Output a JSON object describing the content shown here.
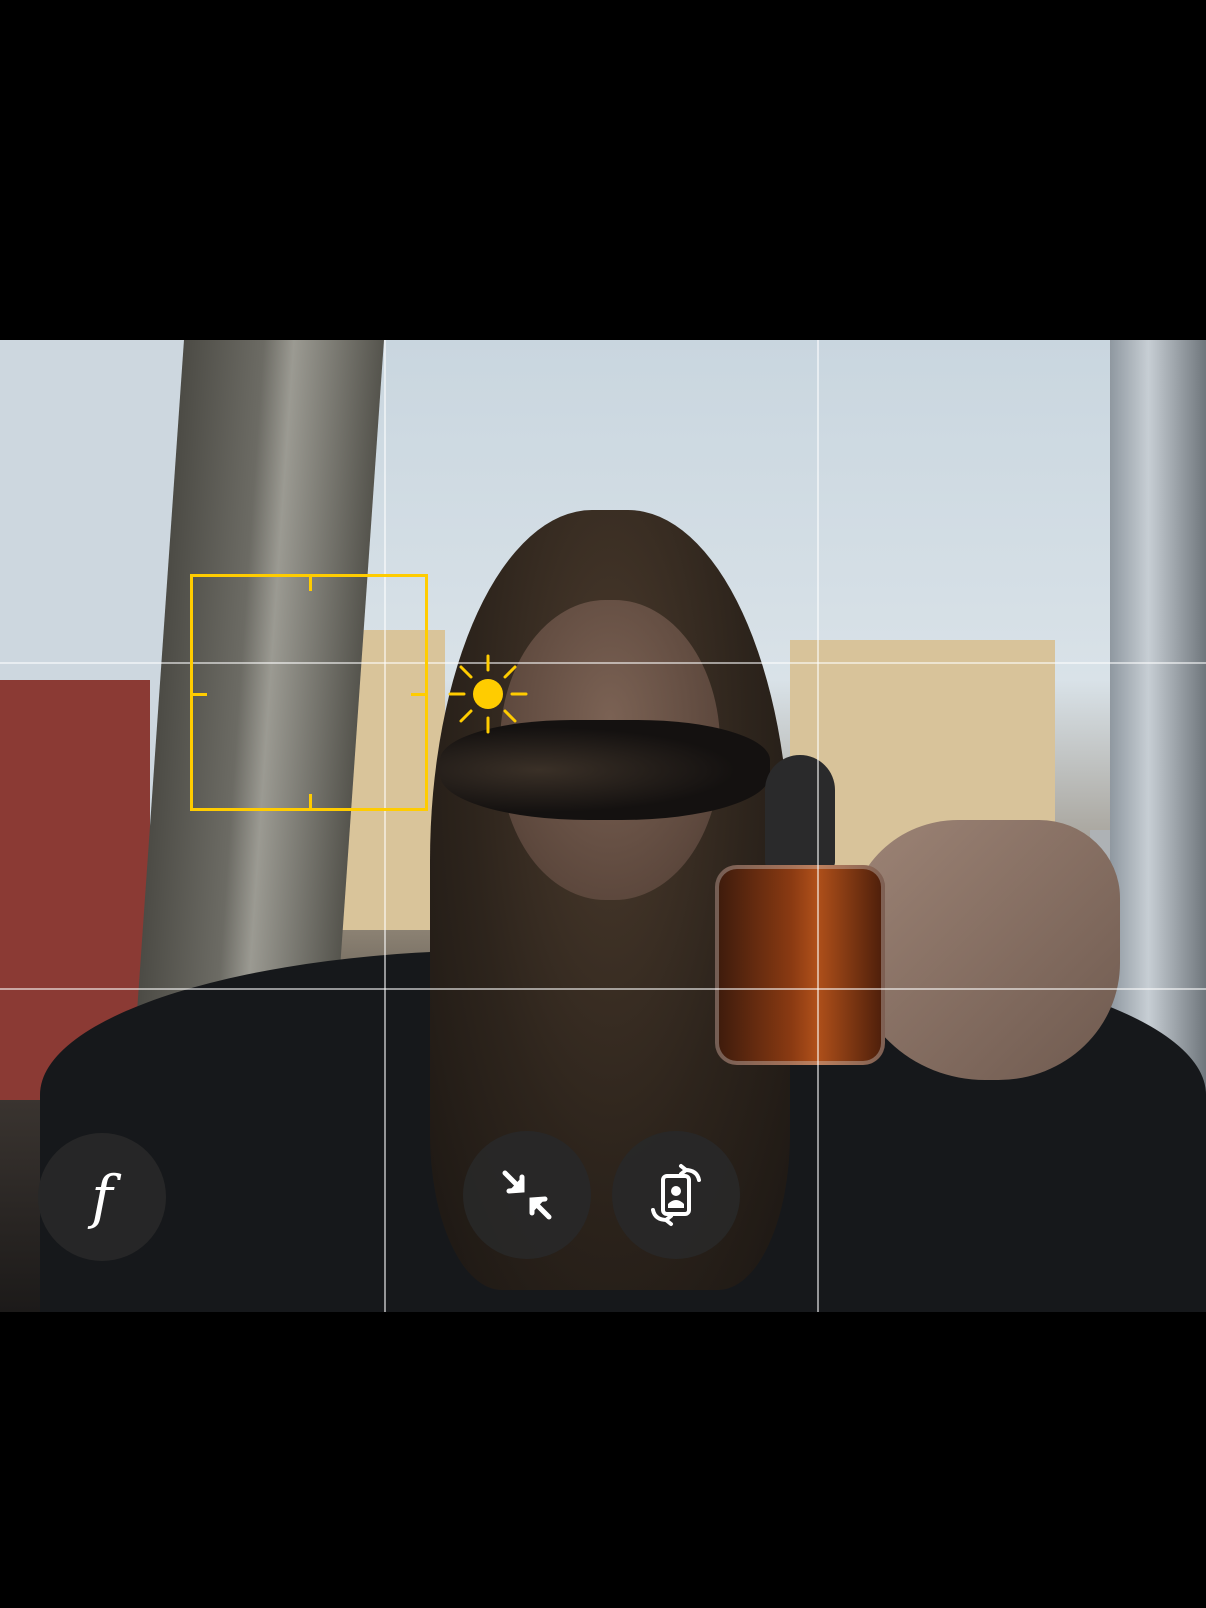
{
  "app": {
    "mode": "camera-viewfinder"
  },
  "overlay": {
    "grid": true,
    "focus_box_color": "#ffcc00",
    "exposure_icon": "sun-icon"
  },
  "controls": {
    "aperture": {
      "icon": "aperture-f-icon",
      "glyph": "f"
    },
    "zoom": {
      "icon": "collapse-arrows-icon"
    },
    "rotate": {
      "icon": "portrait-rotate-icon"
    }
  }
}
